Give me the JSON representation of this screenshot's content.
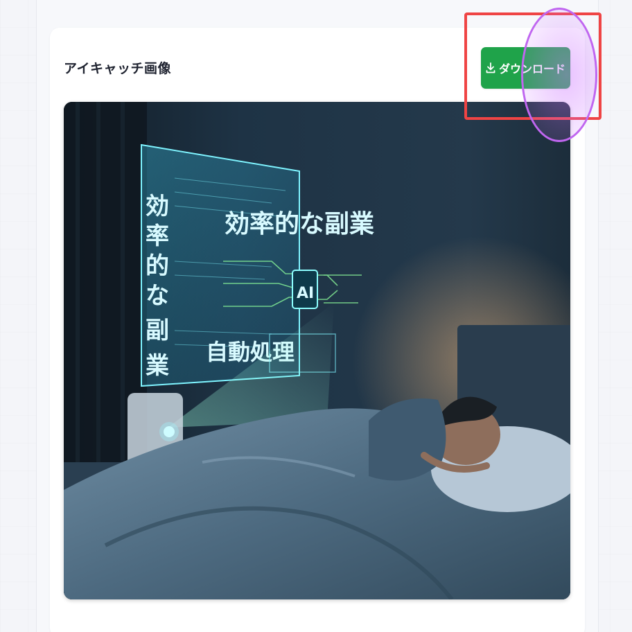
{
  "card": {
    "title": "アイキャッチ画像",
    "download_label": "ダウンロード"
  },
  "image": {
    "vertical_text": [
      "効",
      "率",
      "的",
      "な",
      "副",
      "業"
    ],
    "headline": "効率的な副業",
    "chip_label": "AI",
    "sub_label": "自動処理"
  },
  "icons": {
    "download": "download-icon"
  },
  "colors": {
    "button": "#1fa34a",
    "highlight_box": "#ef4444",
    "highlight_circle": "#c066f0",
    "holo": "#6ff0ff"
  }
}
